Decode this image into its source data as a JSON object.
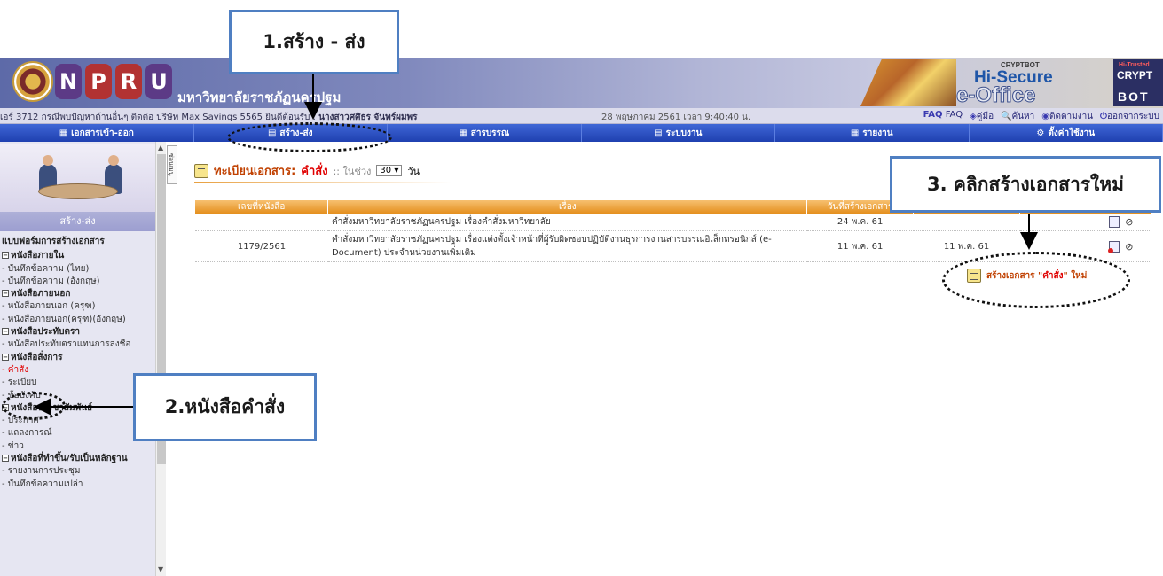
{
  "banner": {
    "logo_letters": [
      "N",
      "P",
      "R",
      "U"
    ],
    "university_name": "มหาวิทยาลัยราชภัฏนครปฐม",
    "brand_cryptbot": "CRYPTBOT",
    "brand_hisecure": "Hi-Secure",
    "brand_eoffice": "e-Office",
    "brand_hitrusted": "Hi-Trusted",
    "brand_crypt": "CRYPT",
    "brand_bot": "BOT"
  },
  "statusbar": {
    "announcement": "เอร์ 3712 กรณีพบปัญหาด้านอื่นๆ ติดต่อ บริษัท Max Savings 5565  ยินดีต้อนรับ : ",
    "user_name": "นางสาวศศิธร จันทร์ผมพร",
    "datetime": "28 พฤษภาคม 2561  เวลา 9:40:40 น.",
    "links": [
      {
        "icon": "FAQ",
        "label": "FAQ"
      },
      {
        "icon": "◈",
        "label": "คู่มือ"
      },
      {
        "icon": "🔍",
        "label": "ค้นหา"
      },
      {
        "icon": "◉",
        "label": "ติดตามงาน"
      },
      {
        "icon": "⏻",
        "label": "ออกจากระบบ"
      }
    ]
  },
  "nav": [
    {
      "label": "เอกสารเข้า-ออก",
      "icon": "▦"
    },
    {
      "label": "สร้าง-ส่ง",
      "icon": "▤"
    },
    {
      "label": "สารบรรณ",
      "icon": "▦"
    },
    {
      "label": "ระบบงาน",
      "icon": "▤"
    },
    {
      "label": "รายงาน",
      "icon": "▦"
    },
    {
      "label": "ตั้งค่าใช้งาน",
      "icon": "⚙"
    }
  ],
  "sidebar": {
    "section_title": "สร้าง-ส่ง",
    "form_heading": "แบบฟอร์มการสร้างเอกสาร",
    "groups": [
      {
        "title": "หนังสือภายใน",
        "items": [
          "- บันทึกข้อความ (ไทย)",
          "- บันทึกข้อความ (อังกฤษ)"
        ]
      },
      {
        "title": "หนังสือภายนอก",
        "items": [
          "- หนังสือภายนอก (ครุฑ)",
          "- หนังสือภายนอก(ครุฑ)(อังกฤษ)"
        ]
      },
      {
        "title": "หนังสือประทับตรา",
        "items": [
          "- หนังสือประทับตราแทนการลงชื่อ"
        ]
      },
      {
        "title": "หนังสือสั่งการ",
        "items": [
          "- คำสั่ง",
          "- ระเบียบ",
          "- ข้อบังคับ"
        ]
      },
      {
        "title": "หนังสือประชาสัมพันธ์",
        "items": [
          "- ประกาศ",
          "- แถลงการณ์",
          "- ข่าว"
        ]
      },
      {
        "title": "หนังสือที่ทำขึ้น/รับเป็นหลักฐาน",
        "items": [
          "- รายงานการประชุม",
          "- บันทึกข้อความเปล่า"
        ]
      }
    ],
    "hide_tab": "ซ่อนเมนู"
  },
  "main": {
    "title_prefix": "ทะเบียนเอกสาร:",
    "title_type": "คำสั่ง",
    "range_prefix": ":: ในช่วง",
    "range_value": "30",
    "range_suffix": "วัน",
    "columns": [
      "เลขที่หนังสือ",
      "เรื่อง",
      "วันที่สร้างเอกสาร",
      "",
      ""
    ],
    "rows": [
      {
        "number": "",
        "subject": "คำสั่งมหาวิทยาลัยราชภัฏนครปฐม เรื่องคำสั่งมหาวิทยาลัย",
        "created": "24 พ.ค. 61",
        "sent": ""
      },
      {
        "number": "1179/2561",
        "subject": "คำสั่งมหาวิทยาลัยราชภัฏนครปฐม เรื่องแต่งตั้งเจ้าหน้าที่ผู้รับผิดชอบปฏิบัติงานธุรการงานสารบรรณอิเล็กทรอนิกส์ (e-Document) ประจำหน่วยงานเพิ่มเติม",
        "created": "11 พ.ค. 61",
        "sent": "11 พ.ค. 61"
      }
    ],
    "create_new_prefix": "สร้างเอกสาร \"",
    "create_new_type": "คำสั่ง",
    "create_new_suffix": "\" ใหม่"
  },
  "callouts": {
    "step1": "1.สร้าง - ส่ง",
    "step2": "2.หนังสือคำสั่ง",
    "step3": "3. คลิกสร้างเอกสารใหม่"
  },
  "colors": {
    "nav_blue": "#1f40b0",
    "nav_active": "#f5b400",
    "callout_border": "#4f7fc2",
    "table_header": "#e48f1e",
    "accent_red": "#e00000"
  }
}
